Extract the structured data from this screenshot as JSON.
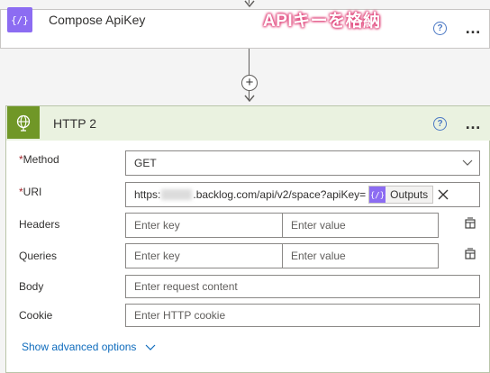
{
  "compose": {
    "title": "Compose ApiKey",
    "annotation": "APIキーを格納",
    "help_icon": "?",
    "more_icon": "…"
  },
  "connector": {
    "plus_icon": "+"
  },
  "http": {
    "title": "HTTP 2",
    "help_icon": "?",
    "more_icon": "…",
    "method": {
      "label": "Method",
      "value": "GET"
    },
    "uri": {
      "label": "URI",
      "prefix": "https:",
      "suffix": ".backlog.com/api/v2/space?apiKey=",
      "token_label": "Outputs"
    },
    "headers": {
      "label": "Headers",
      "key_placeholder": "Enter key",
      "value_placeholder": "Enter value"
    },
    "queries": {
      "label": "Queries",
      "key_placeholder": "Enter key",
      "value_placeholder": "Enter value"
    },
    "body": {
      "label": "Body",
      "placeholder": "Enter request content"
    },
    "cookie": {
      "label": "Cookie",
      "placeholder": "Enter HTTP cookie"
    },
    "show_advanced": "Show advanced options"
  },
  "colors": {
    "compose_accent": "#8c6cf2",
    "http_accent": "#709727",
    "annotation_outline": "#e0457b",
    "link": "#0f6cbd"
  }
}
